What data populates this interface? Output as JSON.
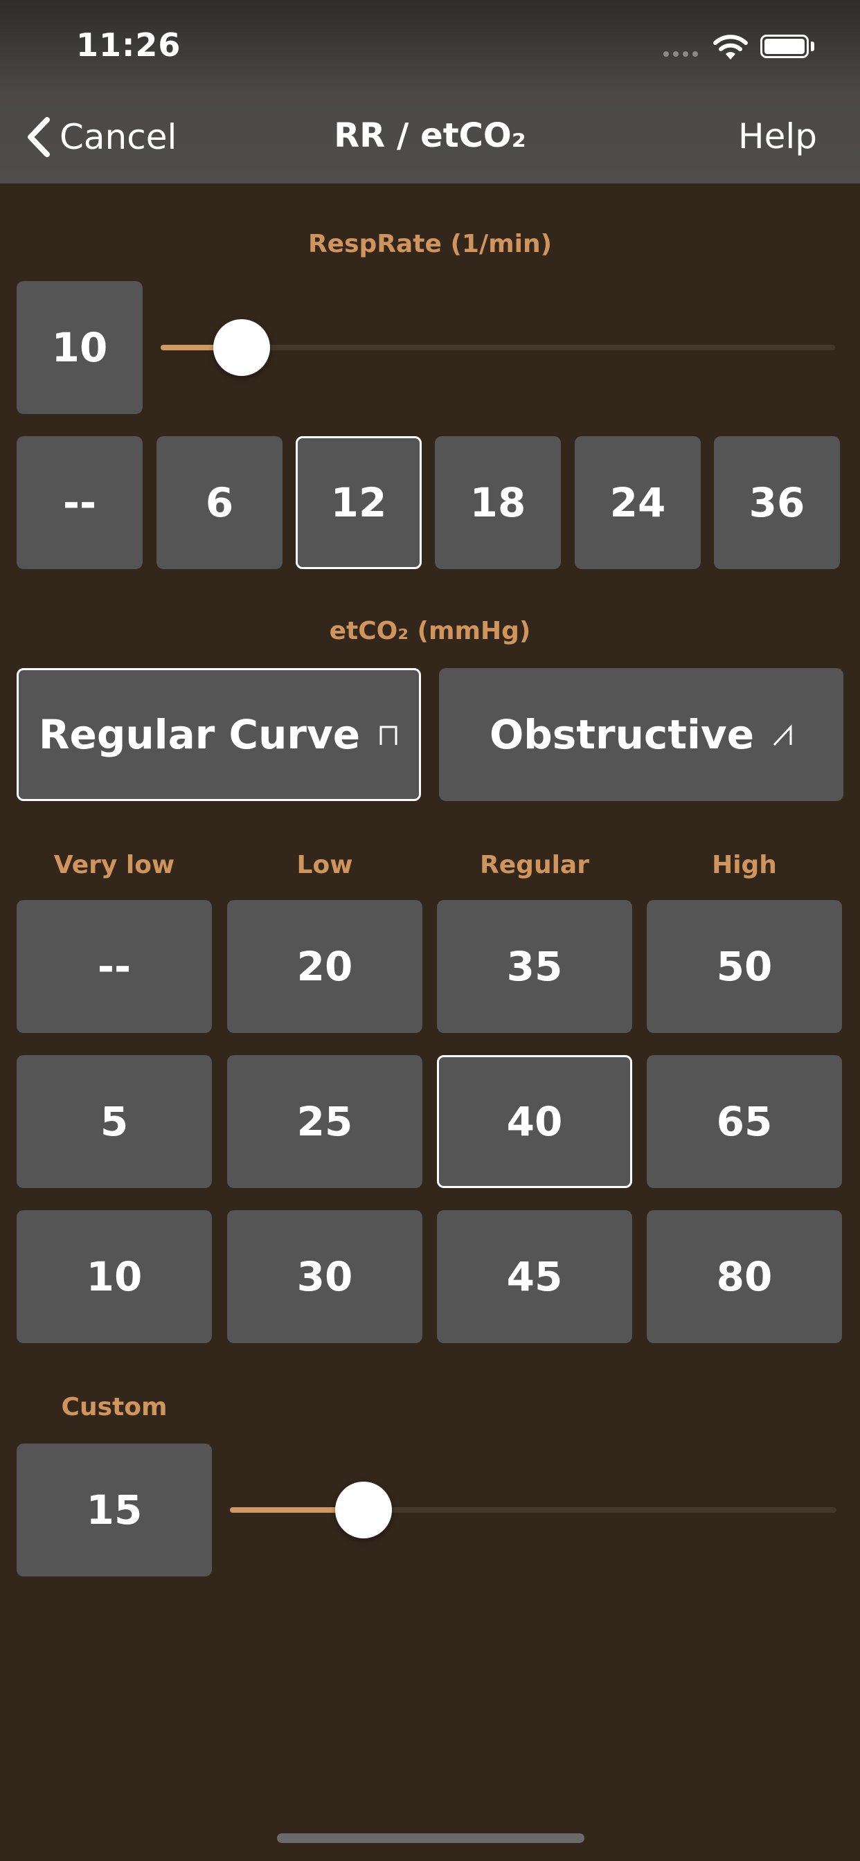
{
  "status_bar": {
    "time": "11:26"
  },
  "nav": {
    "cancel_label": "Cancel",
    "title": "RR / etCO₂",
    "help_label": "Help"
  },
  "resp_rate": {
    "label": "RespRate (1/min)",
    "current_value": "10",
    "slider_fraction": 0.12,
    "presets": [
      "--",
      "6",
      "12",
      "18",
      "24",
      "36"
    ],
    "selected_preset": "12"
  },
  "etco2": {
    "label": "etCO₂ (mmHg)",
    "curve_options": [
      {
        "label": "Regular Curve",
        "icon": "square-wave-icon",
        "selected": true
      },
      {
        "label": "Obstructive",
        "icon": "shark-fin-icon",
        "selected": false
      }
    ],
    "columns": [
      "Very low",
      "Low",
      "Regular",
      "High"
    ],
    "rows": [
      [
        "--",
        "20",
        "35",
        "50"
      ],
      [
        "5",
        "25",
        "40",
        "65"
      ],
      [
        "10",
        "30",
        "45",
        "80"
      ]
    ],
    "selected_value": "40"
  },
  "custom": {
    "label": "Custom",
    "current_value": "15",
    "slider_fraction": 0.22
  },
  "colors": {
    "accent": "#cf955d",
    "background": "#33261b",
    "tile": "#555555"
  }
}
